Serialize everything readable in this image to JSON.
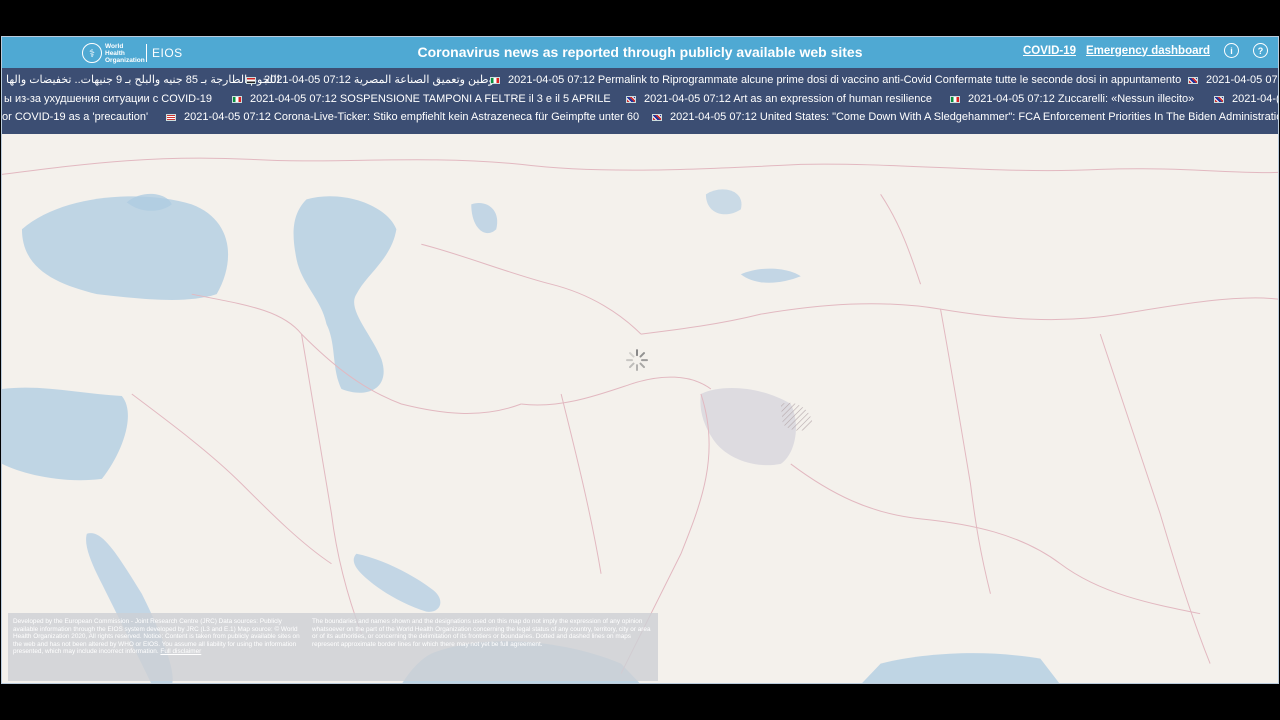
{
  "header": {
    "logo": {
      "org": "World Health Organization",
      "product": "EIOS"
    },
    "title": "Coronavirus news as reported through publicly available web sites",
    "nav": {
      "covid": "COVID-19",
      "dashboard": "Emergency dashboard",
      "info_icon": "info-icon",
      "help_icon": "help-icon"
    }
  },
  "ticker": {
    "rows": [
      [
        {
          "flag": "eg",
          "time": "",
          "text": "اللجوم الطارجة بـ 85 جنيه والبلح بـ 9 جنيهات.. تخفيضات والها"
        },
        {
          "flag": "eg",
          "time": "2021-04-05 07:12",
          "text": "توطين وتعميق الصناعة المصرية"
        },
        {
          "flag": "it",
          "time": "2021-04-05 07:12",
          "text": "Permalink to Riprogrammate alcune prime dosi di vaccino anti-Covid Confermate tutte le seconde dosi in appuntamento"
        },
        {
          "flag": "uk",
          "time": "2021-04-05 07",
          "text": ""
        }
      ],
      [
        {
          "flag": "",
          "time": "",
          "text": "ы из-за ухудшения ситуации с COVID-19"
        },
        {
          "flag": "it",
          "time": "2021-04-05 07:12",
          "text": "SOSPENSIONE TAMPONI A FELTRE il 3 e il 5 APRILE"
        },
        {
          "flag": "uk",
          "time": "2021-04-05 07:12",
          "text": "Art as an expression of human resilience"
        },
        {
          "flag": "it",
          "time": "2021-04-05 07:12",
          "text": "Zuccarelli: «Nessun illecito»"
        },
        {
          "flag": "uk",
          "time": "2021-04-(",
          "text": ""
        }
      ],
      [
        {
          "flag": "",
          "time": "",
          "text": "or COVID-19 as a 'precaution'"
        },
        {
          "flag": "us",
          "time": "2021-04-05 07:12",
          "text": "Corona-Live-Ticker: Stiko empfiehlt kein Astrazeneca für Geimpfte unter 60"
        },
        {
          "flag": "uk",
          "time": "2021-04-05 07:12",
          "text": "United States: \"Come Down With A Sledgehammer\": FCA Enforcement Priorities In The Biden Administration"
        }
      ]
    ]
  },
  "disclaimer": {
    "left": "Developed by the European Commission - Joint Research Centre (JRC) Data sources: Publicly available information through the EIOS system developed by JRC (L3 and E.1) Map source: © World Health Organization 2020, All rights reserved. Notice: Content is taken from publicly available sites on the web and has not been altered by WHO or EIOS. You assume all liability for using the information presented, which may include incorrect information.",
    "left_link": "Full disclaimer",
    "right": "The boundaries and names shown and the designations used on this map do not imply the expression of any opinion whatsoever on the part of the World Health Organization concerning the legal status of any country, territory, city or area or of its authorities, or concerning the delimitation of its frontiers or boundaries. Dotted and dashed lines on maps represent approximate border lines for which there may not yet be full agreement."
  },
  "colors": {
    "header": "#4fa9d3",
    "ticker": "#3c4e73",
    "land": "#f4f1ec",
    "water": "#aecbe2",
    "border": "#e2b8c0"
  }
}
